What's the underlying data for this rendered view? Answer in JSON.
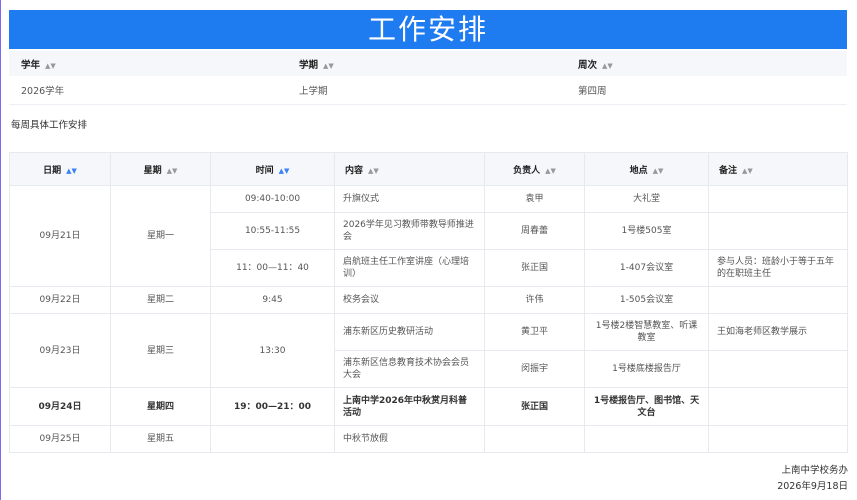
{
  "page": {
    "title": "工作安排",
    "subtitle": "每周具体工作安排"
  },
  "meta": {
    "headers": [
      "学年",
      "学期",
      "周次"
    ],
    "values": [
      "2026学年",
      "上学期",
      "第四周"
    ]
  },
  "table": {
    "headers": [
      "日期",
      "星期",
      "时间",
      "内容",
      "负责人",
      "地点",
      "备注"
    ],
    "rows": [
      {
        "date": "09月21日",
        "weekday": "星期一",
        "time": "09:40-10:00",
        "content": "升旗仪式",
        "person": "袁甲",
        "location": "大礼堂",
        "note": ""
      },
      {
        "time": "10:55-11:55",
        "content": "2026学年见习教师带教导师推进会",
        "person": "周春蕾",
        "location": "1号楼505室",
        "note": ""
      },
      {
        "time": "11：00—11：40",
        "content": "启航班主任工作室讲座（心理培训）",
        "person": "张正国",
        "location": "1-407会议室",
        "note": "参与人员：班龄小于等于五年的在职班主任"
      },
      {
        "date": "09月22日",
        "weekday": "星期二",
        "time": "9:45",
        "content": "校务会议",
        "person": "许伟",
        "location": "1-505会议室",
        "note": ""
      },
      {
        "date": "09月23日",
        "weekday": "星期三",
        "time": "13:30",
        "content": "浦东新区历史教研活动",
        "person": "黄卫平",
        "location": "1号楼2楼智慧教室、听课教室",
        "note": "王如海老师区教学展示"
      },
      {
        "content": "浦东新区信息教育技术协会会员大会",
        "person": "闵振宇",
        "location": "1号楼底楼报告厅",
        "note": ""
      },
      {
        "date": "09月24日",
        "weekday": "星期四",
        "time": "19：00—21：00",
        "content": "上南中学2026年中秋赏月科普活动",
        "person": "张正国",
        "location": "1号楼报告厅、图书馆、天文台",
        "note": ""
      },
      {
        "date": "09月25日",
        "weekday": "星期五",
        "time": "",
        "content": "中秋节放假",
        "person": "",
        "location": "",
        "note": ""
      }
    ]
  },
  "footer": {
    "org": "上南中学校务办",
    "date": "2026年9月18日"
  }
}
